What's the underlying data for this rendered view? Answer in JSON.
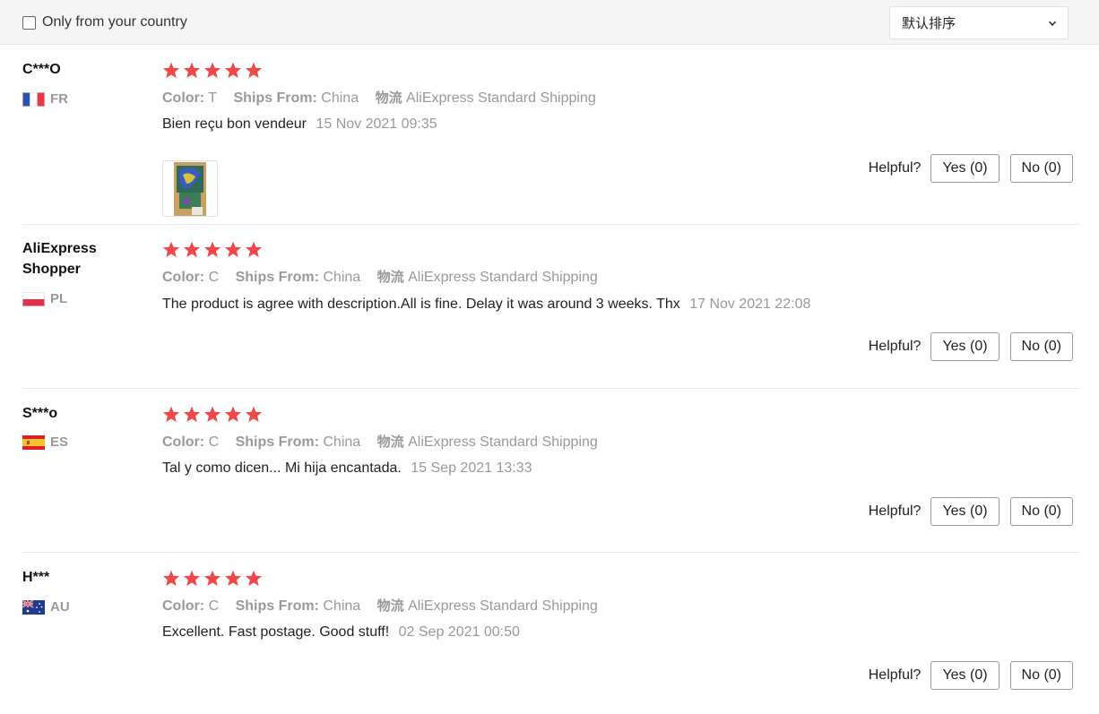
{
  "filter": {
    "only_country_label": "Only from your country",
    "only_country_checked": false,
    "sort_value": "默认排序"
  },
  "labels": {
    "color_key": "Color:",
    "ships_key": "Ships From:",
    "logistics_key": "物流",
    "helpful": "Helpful?"
  },
  "reviews": [
    {
      "user": "C***O",
      "country": "FR",
      "flag": "france-flag",
      "rating": 5,
      "color": "T",
      "ships_from": "China",
      "logistics": "AliExpress Standard Shipping",
      "text": "Bien reçu bon vendeur",
      "date": "15 Nov 2021 09:35",
      "has_photo": true,
      "yes": "Yes (0)",
      "no": "No (0)"
    },
    {
      "user": "AliExpress Shopper",
      "country": "PL",
      "flag": "poland-flag",
      "rating": 5,
      "color": "C",
      "ships_from": "China",
      "logistics": "AliExpress Standard Shipping",
      "text": "The product is agree with description.All is fine. Delay it was around 3 weeks. Thx",
      "date": "17 Nov 2021 22:08",
      "has_photo": false,
      "yes": "Yes (0)",
      "no": "No (0)"
    },
    {
      "user": "S***o",
      "country": "ES",
      "flag": "spain-flag",
      "rating": 5,
      "color": "C",
      "ships_from": "China",
      "logistics": "AliExpress Standard Shipping",
      "text": "Tal y como dicen... Mi hija encantada.",
      "date": "15 Sep 2021 13:33",
      "has_photo": false,
      "yes": "Yes (0)",
      "no": "No (0)"
    },
    {
      "user": "H***",
      "country": "AU",
      "flag": "australia-flag",
      "rating": 5,
      "color": "C",
      "ships_from": "China",
      "logistics": "AliExpress Standard Shipping",
      "text": "Excellent. Fast postage. Good stuff!",
      "date": "02 Sep 2021 00:50",
      "has_photo": false,
      "yes": "Yes (0)",
      "no": "No (0)"
    }
  ],
  "colors": {
    "star": "#f04848",
    "muted_text": "#999999",
    "divider": "#e8e8e8"
  }
}
